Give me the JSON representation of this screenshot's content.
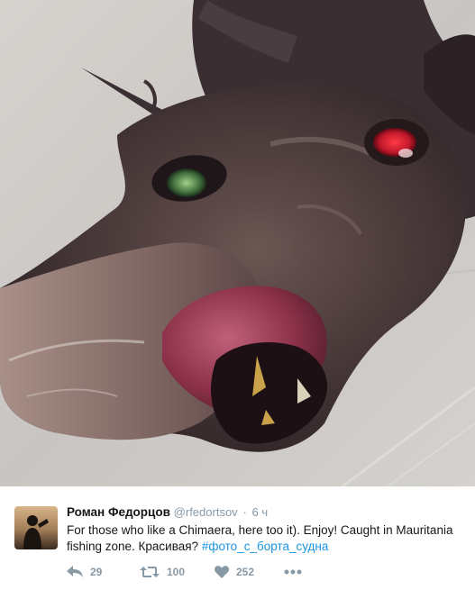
{
  "tweet": {
    "author_name": "Роман Федорцов",
    "author_handle": "@rfedortsov",
    "separator": "·",
    "time": "6 ч",
    "text": "For those who like a Chimaera, here too it). Enjoy! Caught in Mauritania fishing zone. Красивая? ",
    "hashtag": "#фото_с_борта_судна"
  },
  "actions": {
    "reply_count": "29",
    "retweet_count": "100",
    "like_count": "252"
  },
  "icons": {
    "reply": "reply-icon",
    "retweet": "retweet-icon",
    "like": "heart-icon",
    "more": "more-icon"
  },
  "colors": {
    "hashtag": "#1b95e0",
    "muted": "#8899a6",
    "text": "#14171a"
  }
}
